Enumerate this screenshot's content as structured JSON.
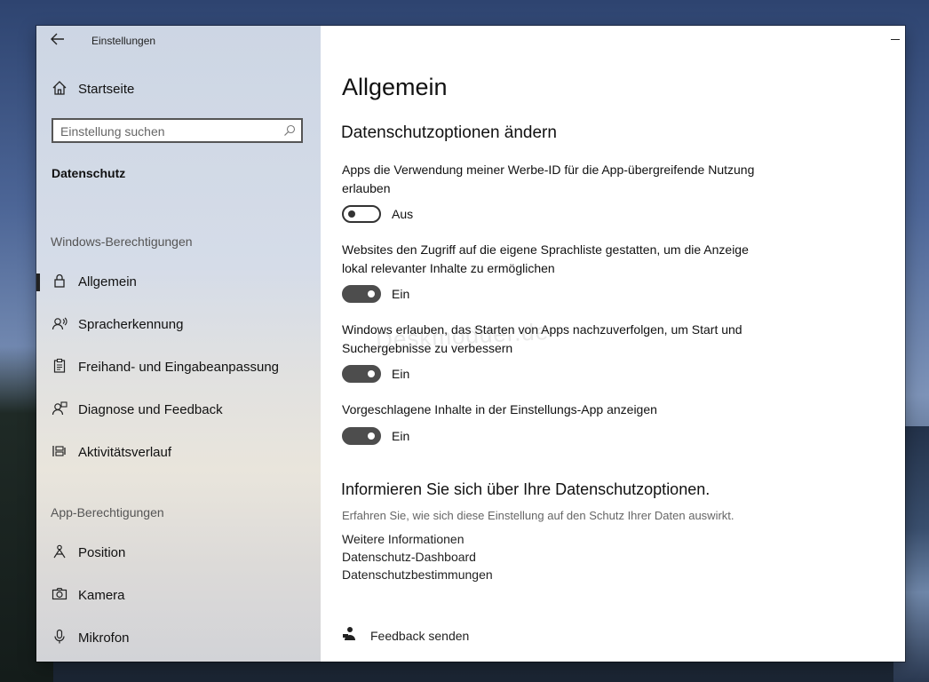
{
  "window": {
    "title": "Einstellungen"
  },
  "sidebar": {
    "home": "Startseite",
    "search_placeholder": "Einstellung suchen",
    "current_category": "Datenschutz",
    "windows_permissions_heading": "Windows-Berechtigungen",
    "windows_items": [
      {
        "label": "Allgemein",
        "icon": "lock-icon",
        "active": true
      },
      {
        "label": "Spracherkennung",
        "icon": "speech-icon"
      },
      {
        "label": "Freihand- und Eingabeanpassung",
        "icon": "clipboard-icon"
      },
      {
        "label": "Diagnose und Feedback",
        "icon": "diagnostics-icon"
      },
      {
        "label": "Aktivitätsverlauf",
        "icon": "activity-history-icon"
      }
    ],
    "app_permissions_heading": "App-Berechtigungen",
    "app_items": [
      {
        "label": "Position",
        "icon": "location-icon"
      },
      {
        "label": "Kamera",
        "icon": "camera-icon"
      },
      {
        "label": "Mikrofon",
        "icon": "microphone-icon"
      }
    ]
  },
  "main": {
    "title": "Allgemein",
    "section_title": "Datenschutzoptionen ändern",
    "settings": [
      {
        "description": "Apps die Verwendung meiner Werbe-ID für die App-übergreifende Nutzung erlauben",
        "state": "Aus",
        "on": false
      },
      {
        "description": "Websites den Zugriff auf die eigene Sprachliste gestatten, um die Anzeige lokal relevanter Inhalte zu ermöglichen",
        "state": "Ein",
        "on": true
      },
      {
        "description": "Windows erlauben, das Starten von Apps nachzuverfolgen, um Start und Suchergebnisse zu verbessern",
        "state": "Ein",
        "on": true
      },
      {
        "description": "Vorgeschlagene Inhalte in der Einstellungs-App anzeigen",
        "state": "Ein",
        "on": true
      }
    ],
    "info": {
      "heading": "Informieren Sie sich über Ihre Datenschutzoptionen.",
      "text": "Erfahren Sie, wie sich diese Einstellung auf den Schutz Ihrer Daten auswirkt.",
      "links": [
        "Weitere Informationen",
        "Datenschutz-Dashboard",
        "Datenschutzbestimmungen"
      ]
    },
    "feedback": "Feedback senden",
    "watermark": "Deskmodder.de"
  }
}
